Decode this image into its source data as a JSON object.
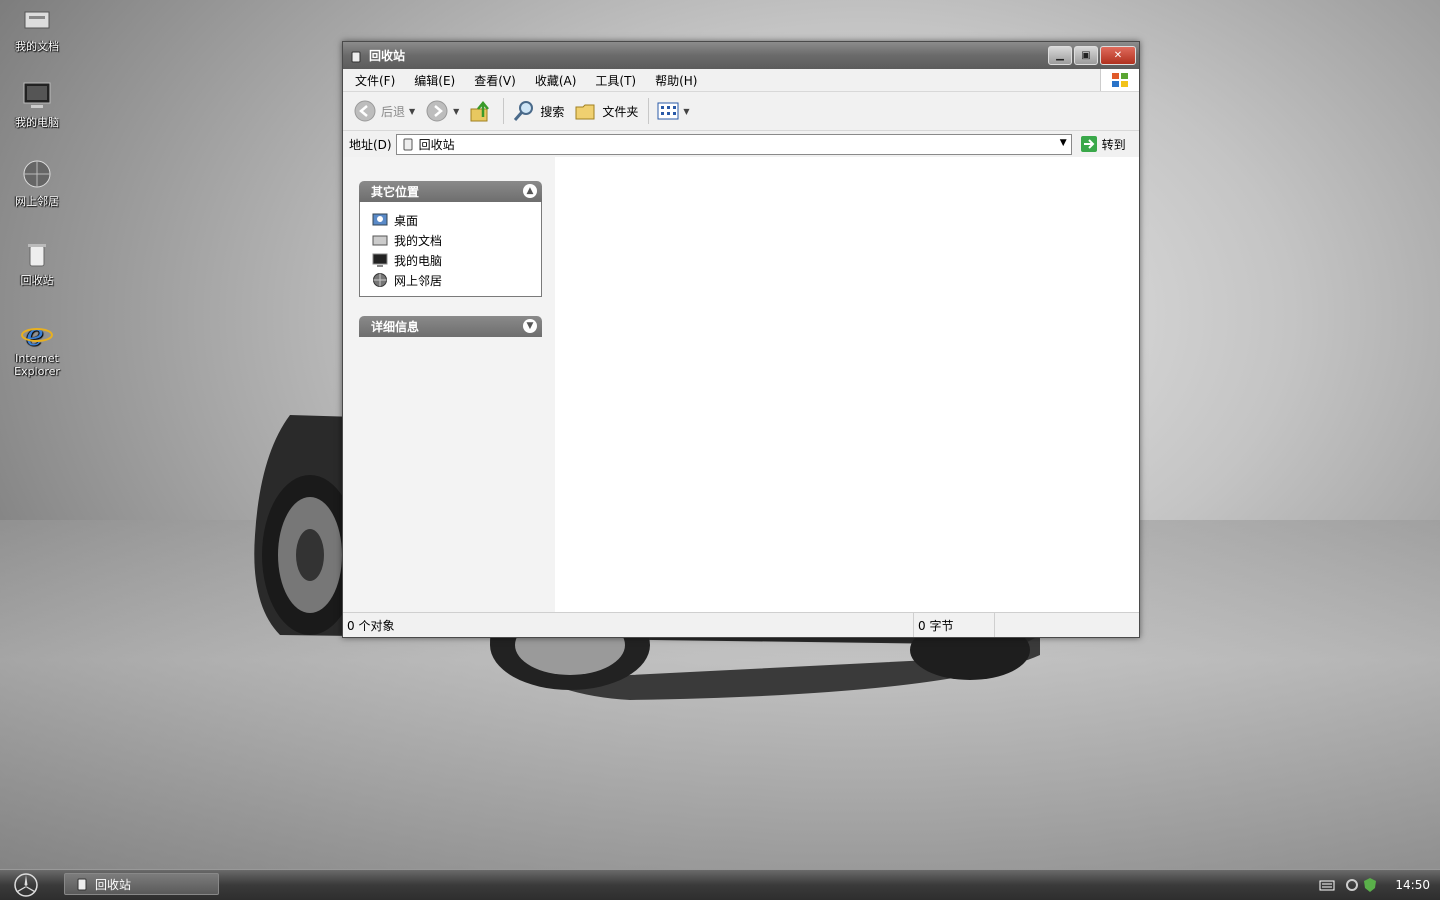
{
  "desktop": {
    "icons": [
      {
        "label": "我的文档"
      },
      {
        "label": "我的电脑"
      },
      {
        "label": "网上邻居"
      },
      {
        "label": "回收站"
      },
      {
        "label": "Internet Explorer"
      }
    ]
  },
  "window": {
    "title": "回收站",
    "menu": [
      "文件(F)",
      "编辑(E)",
      "查看(V)",
      "收藏(A)",
      "工具(T)",
      "帮助(H)"
    ],
    "toolbar": {
      "back": "后退",
      "search": "搜索",
      "folders": "文件夹"
    },
    "address": {
      "label": "地址(D)",
      "value": "回收站",
      "go": "转到"
    },
    "left_pane": {
      "other_places": {
        "title": "其它位置",
        "items": [
          "桌面",
          "我的文档",
          "我的电脑",
          "网上邻居"
        ]
      },
      "details": {
        "title": "详细信息"
      }
    },
    "status": {
      "objects": "0 个对象",
      "size": "0 字节"
    }
  },
  "taskbar": {
    "task": "回收站",
    "clock": "14:50"
  }
}
